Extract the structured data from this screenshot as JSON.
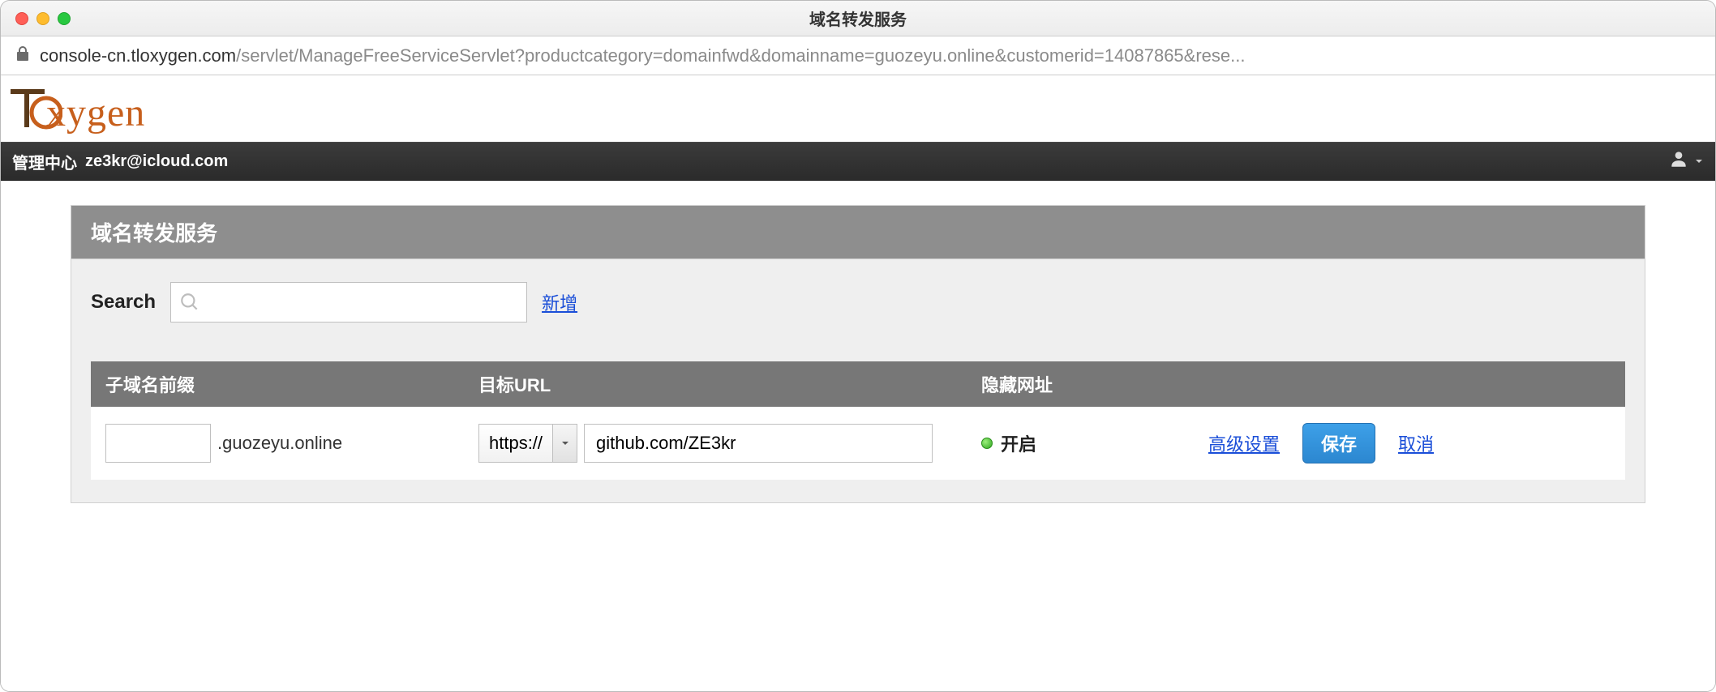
{
  "window": {
    "title": "域名转发服务"
  },
  "address": {
    "domain": "console-cn.tloxygen.com",
    "path": "/servlet/ManageFreeServiceServlet?productcategory=domainfwd&domainname=guozeyu.online&customerid=14087865&rese..."
  },
  "logo": {
    "text_rest": "xygen"
  },
  "topnav": {
    "label": "管理中心",
    "email": "ze3kr@icloud.com"
  },
  "panel": {
    "title": "域名转发服务",
    "search_label": "Search",
    "search_placeholder": "",
    "add_link": "新增"
  },
  "table": {
    "headers": {
      "sub": "子域名前缀",
      "url": "目标URL",
      "hide": "隐藏网址"
    },
    "row": {
      "sub_value": "",
      "domain_suffix": ".guozeyu.online",
      "protocol": "https://",
      "target_value": "github.com/ZE3kr",
      "hide_status": "开启",
      "advanced": "高级设置",
      "save": "保存",
      "cancel": "取消"
    }
  }
}
